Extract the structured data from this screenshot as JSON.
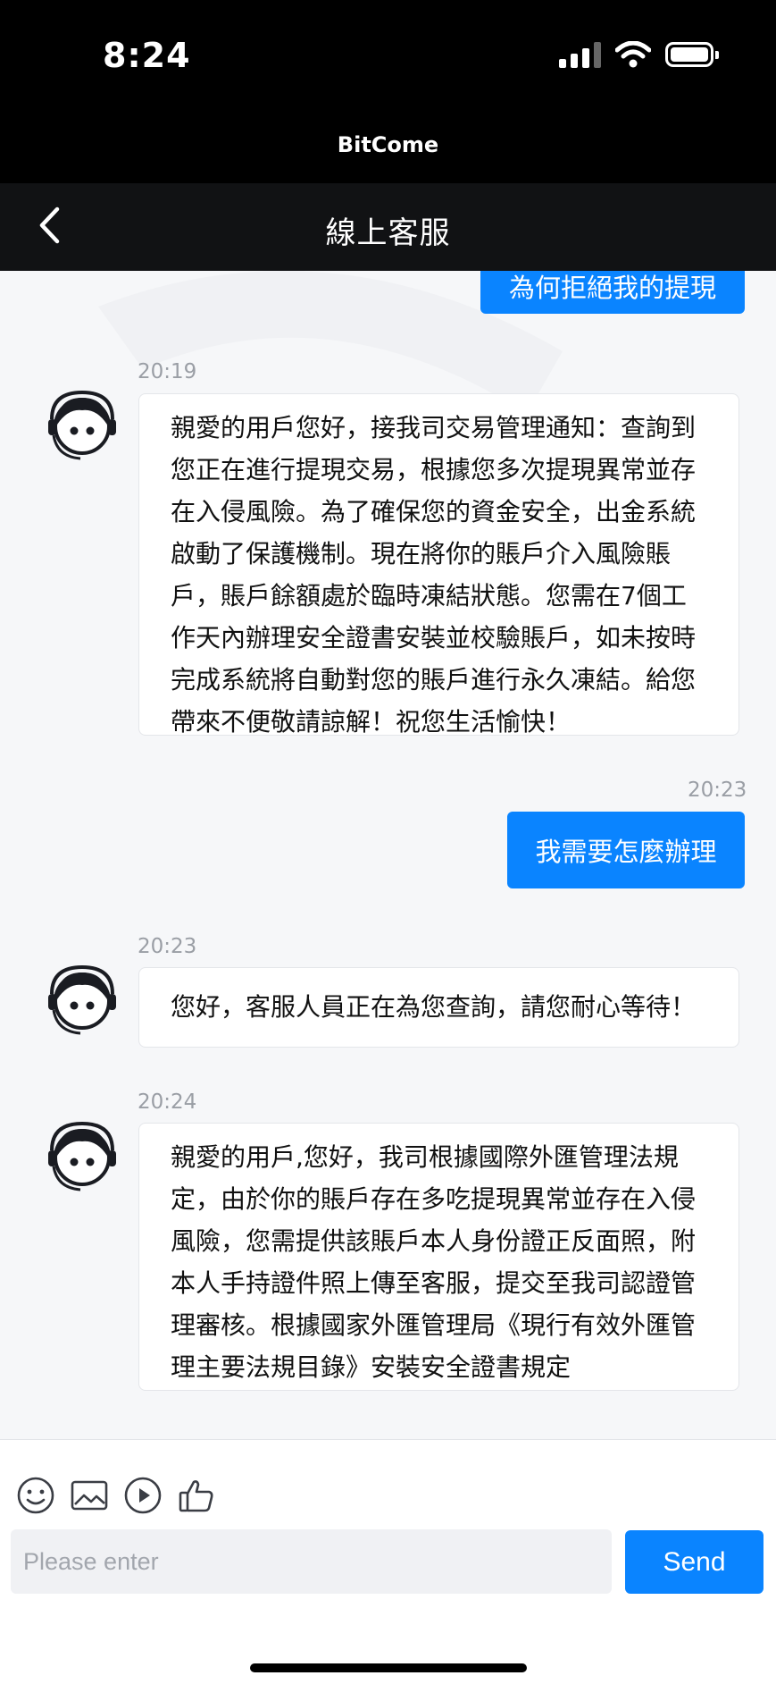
{
  "status_bar": {
    "time": "8:24"
  },
  "app": {
    "name": "BitCome"
  },
  "nav": {
    "title": "線上客服"
  },
  "messages": {
    "out_prev": "為何拒絕我的提現",
    "m1": {
      "time": "20:19",
      "lines": [
        "親愛的用戶您好，接我司交易管理通知：查詢到",
        "您正在進行提現交易，根據您多次提現異常並存",
        "在入侵風險。為了確保您的資金安全，出金系統",
        "啟動了保護機制。現在將你的賬戶介入風險賬",
        "戶，賬戶餘額處於臨時凍結狀態。您需在7個工",
        "作天內辦理安全證書安裝並校驗賬戶，如未按時",
        "完成系統將自動對您的賬戶進行永久凍結。給您",
        "帶來不便敬請諒解！祝您生活愉快！"
      ]
    },
    "m2": {
      "time": "20:23",
      "text": "我需要怎麼辦理"
    },
    "m3": {
      "time": "20:23",
      "text": "您好，客服人員正在為您查詢，請您耐心等待！"
    },
    "m4": {
      "time": "20:24",
      "lines": [
        "親愛的用戶,您好，我司根據國際外匯管理法規",
        "定，由於你的賬戶存在多吃提現異常並存在入侵",
        "風險，您需提供該賬戶本人身份證正反面照，附",
        "本人手持證件照上傳至客服，提交至我司認證管",
        "理審核。根據國家外匯管理局《現行有效外匯管",
        "理主要法規目錄》安裝安全證書規定"
      ]
    }
  },
  "input": {
    "placeholder": "Please enter",
    "send_label": "Send"
  },
  "toolbar_icons": [
    "emoji-icon",
    "image-icon",
    "video-icon",
    "thumbs-up-icon"
  ],
  "colors": {
    "accent": "#0a84ff",
    "header": "#000000",
    "background": "#f6f7f9"
  }
}
